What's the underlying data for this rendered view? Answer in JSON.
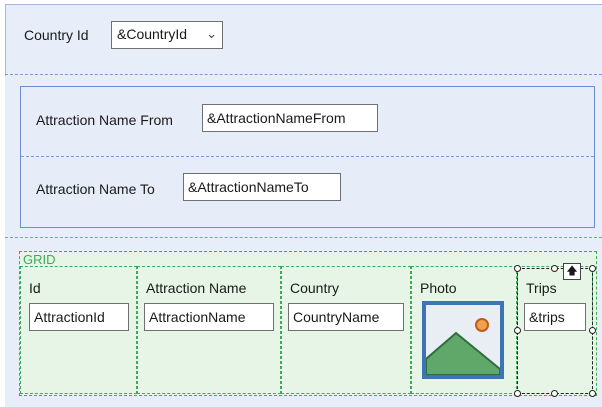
{
  "country": {
    "label": "Country Id",
    "dropdown_value": "&CountryId",
    "chevron_icon": "chevron-down-icon"
  },
  "attraction": {
    "from_label": "Attraction Name From",
    "from_value": "&AttractionNameFrom",
    "to_label": "Attraction Name To",
    "to_value": "&AttractionNameTo"
  },
  "grid": {
    "title": "GRID",
    "columns": [
      {
        "header": "Id",
        "value": "AttractionId"
      },
      {
        "header": "Attraction Name",
        "value": "AttractionName"
      },
      {
        "header": "Country",
        "value": "CountryName"
      },
      {
        "header": "Photo",
        "value": ""
      },
      {
        "header": "Trips",
        "value": "&trips"
      }
    ]
  },
  "colors": {
    "section_bg": "#e8eef9",
    "section_border": "#6a8fd0",
    "grid_bg": "#e6f5e6",
    "grid_border": "#3caa5a",
    "photo_bg": "#3d74b6"
  }
}
